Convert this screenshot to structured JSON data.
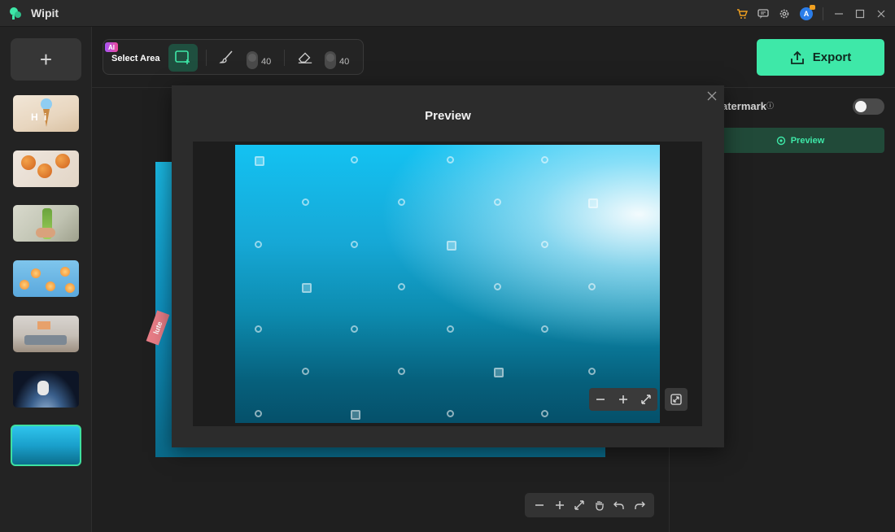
{
  "app": {
    "title": "Wipit"
  },
  "titlebar": {
    "icons": [
      "cart-icon",
      "chat-icon",
      "gear-icon",
      "avatar",
      "minimize-icon",
      "maximize-icon",
      "close-icon"
    ],
    "avatar_initial": "A"
  },
  "sidebar": {
    "add_label": "+",
    "thumbnails": [
      {
        "name": "ice-cream",
        "text": "H   i"
      },
      {
        "name": "oranges"
      },
      {
        "name": "green-bottle"
      },
      {
        "name": "flowers"
      },
      {
        "name": "living-room"
      },
      {
        "name": "astronaut"
      },
      {
        "name": "ocean",
        "selected": true
      }
    ]
  },
  "toolbar": {
    "ai_badge": "AI",
    "select_area_label": "Select Area",
    "brush_size": "40",
    "eraser_size": "40"
  },
  "export": {
    "label": "Export"
  },
  "right_panel": {
    "watermark_label": "atermark",
    "info_mark": "?",
    "watermark_toggle": false,
    "preview_label": "Preview"
  },
  "canvas": {
    "stamp_text": "lute"
  },
  "modal": {
    "title": "Preview"
  },
  "colors": {
    "accent": "#3ee8a8",
    "accent_dark": "#214a39",
    "background": "#1f1f1f",
    "titlebar": "#2a2a2a"
  }
}
